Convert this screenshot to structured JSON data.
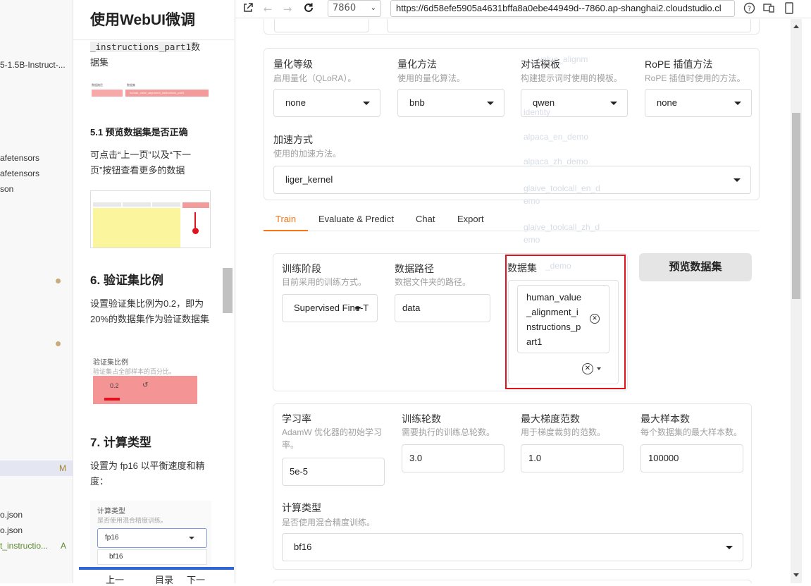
{
  "explorer": {
    "files": [
      {
        "label": "5-1.5B-Instruct-...",
        "badge": ""
      },
      {
        "label": "afetensors",
        "badge": ""
      },
      {
        "label": "afetensors",
        "badge": ""
      },
      {
        "label": "son",
        "badge": ""
      },
      {
        "label": "",
        "badge": "M"
      },
      {
        "label": "o.json",
        "badge": ""
      },
      {
        "label": "o.json",
        "badge": ""
      },
      {
        "label": "t_instructio...",
        "badge": "A"
      }
    ]
  },
  "doc": {
    "title": "使用WebUI微调",
    "dataset_code": "_instructions_part1",
    "dataset_suffix": "数",
    "dataset_line2": "据集",
    "thumb1": {
      "label1": "数据路径",
      "label2": "数据集",
      "value": "human_value_alignment_instructions_part1"
    },
    "h_preview": "5.1 预览数据集是否正确",
    "p_preview": "可点击“上一页”以及“下一页”按钮查看更多的数据",
    "h_val": "6. 验证集比例",
    "p_val": "设置验证集比例为0.2，即为20%的数据集作为验证数据集",
    "thumb3": {
      "title": "验证集比例",
      "subtitle": "验证集占全部样本的百分比。",
      "value": "0.2"
    },
    "h_compute": "7. 计算类型",
    "p_compute": "设置为 fp16 以平衡速度和精度：",
    "thumb4": {
      "title": "计算类型",
      "subtitle": "是否使用混合精度训练。",
      "value": "fp16",
      "option": "bf16"
    },
    "nav": {
      "prev": "上一",
      "toc": "目录",
      "next": "下一"
    }
  },
  "browser": {
    "port": "7860",
    "url": "https://6d58efe5905a4631bffa8a0ebe44949d--7860.ap-shanghai2.cloudstudio.cl"
  },
  "form": {
    "quant_level": {
      "label": "量化等级",
      "info": "启用量化（QLoRA）。",
      "value": "none"
    },
    "quant_method": {
      "label": "量化方法",
      "info": "使用的量化算法。",
      "value": "bnb"
    },
    "template": {
      "label": "对话模板",
      "info": "构建提示词时使用的模板。",
      "value": "qwen"
    },
    "rope": {
      "label": "RoPE 插值方法",
      "info": "RoPE 插值时使用的方法。",
      "value": "none"
    },
    "booster": {
      "label": "加速方式",
      "info": "使用的加速方法。",
      "value": "liger_kernel"
    },
    "tabs": [
      "Train",
      "Evaluate & Predict",
      "Chat",
      "Export"
    ],
    "active_tab": "Train",
    "stage": {
      "label": "训练阶段",
      "info": "目前采用的训练方式。",
      "value": "Supervised Fine-T"
    },
    "dataset_dir": {
      "label": "数据路径",
      "info": "数据文件夹的路径。",
      "value": "data"
    },
    "dataset": {
      "label": "数据集",
      "value": "human_value_alignment_instructions_part1",
      "value_lines": [
        "human_value",
        "_alignment_i",
        "nstructions_p",
        "art1"
      ]
    },
    "preview_button": "预览数据集",
    "ghost_options": [
      "_value_alignm",
      "identity",
      "alpaca_en_demo",
      "alpaca_zh_demo",
      "glaive_toolcall_en_d",
      "emo",
      "glaive_toolcall_zh_d",
      "emo",
      "_demo"
    ],
    "learning_rate": {
      "label": "学习率",
      "info": "AdamW 优化器的初始学习率。",
      "value": "5e-5"
    },
    "epochs": {
      "label": "训练轮数",
      "info": "需要执行的训练总轮数。",
      "value": "3.0"
    },
    "max_grad_norm": {
      "label": "最大梯度范数",
      "info": "用于梯度裁剪的范数。",
      "value": "1.0"
    },
    "max_samples": {
      "label": "最大样本数",
      "info": "每个数据集的最大样本数。",
      "value": "100000"
    },
    "compute_type": {
      "label": "计算类型",
      "info": "是否使用混合精度训练。",
      "value": "bf16"
    }
  },
  "colors": {
    "accent": "#f97316",
    "highlight": "#e0121e"
  }
}
